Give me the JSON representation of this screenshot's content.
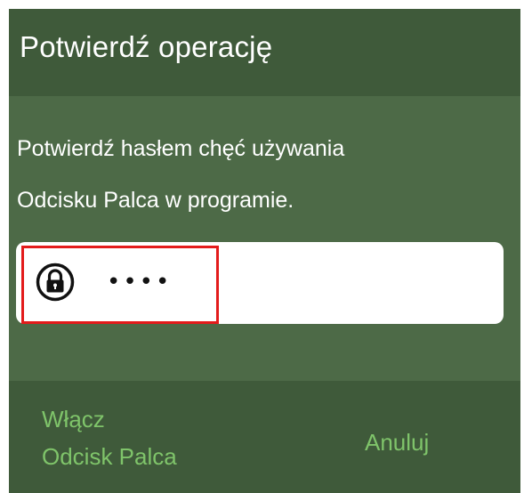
{
  "dialog": {
    "title": "Potwierdź operację",
    "message_line1": "Potwierdź hasłem chęć używania",
    "message_line2": "Odcisku Palca w programie.",
    "password": {
      "masked_value": "••••",
      "icon": "lock-icon"
    },
    "buttons": {
      "confirm_line1": "Włącz",
      "confirm_line2": "Odcisk Palca",
      "cancel": "Anuluj"
    },
    "colors": {
      "body_bg": "#4d6a47",
      "header_bg": "#3f5a3a",
      "button_text": "#7fc46a",
      "highlight": "#e31b1b"
    }
  }
}
